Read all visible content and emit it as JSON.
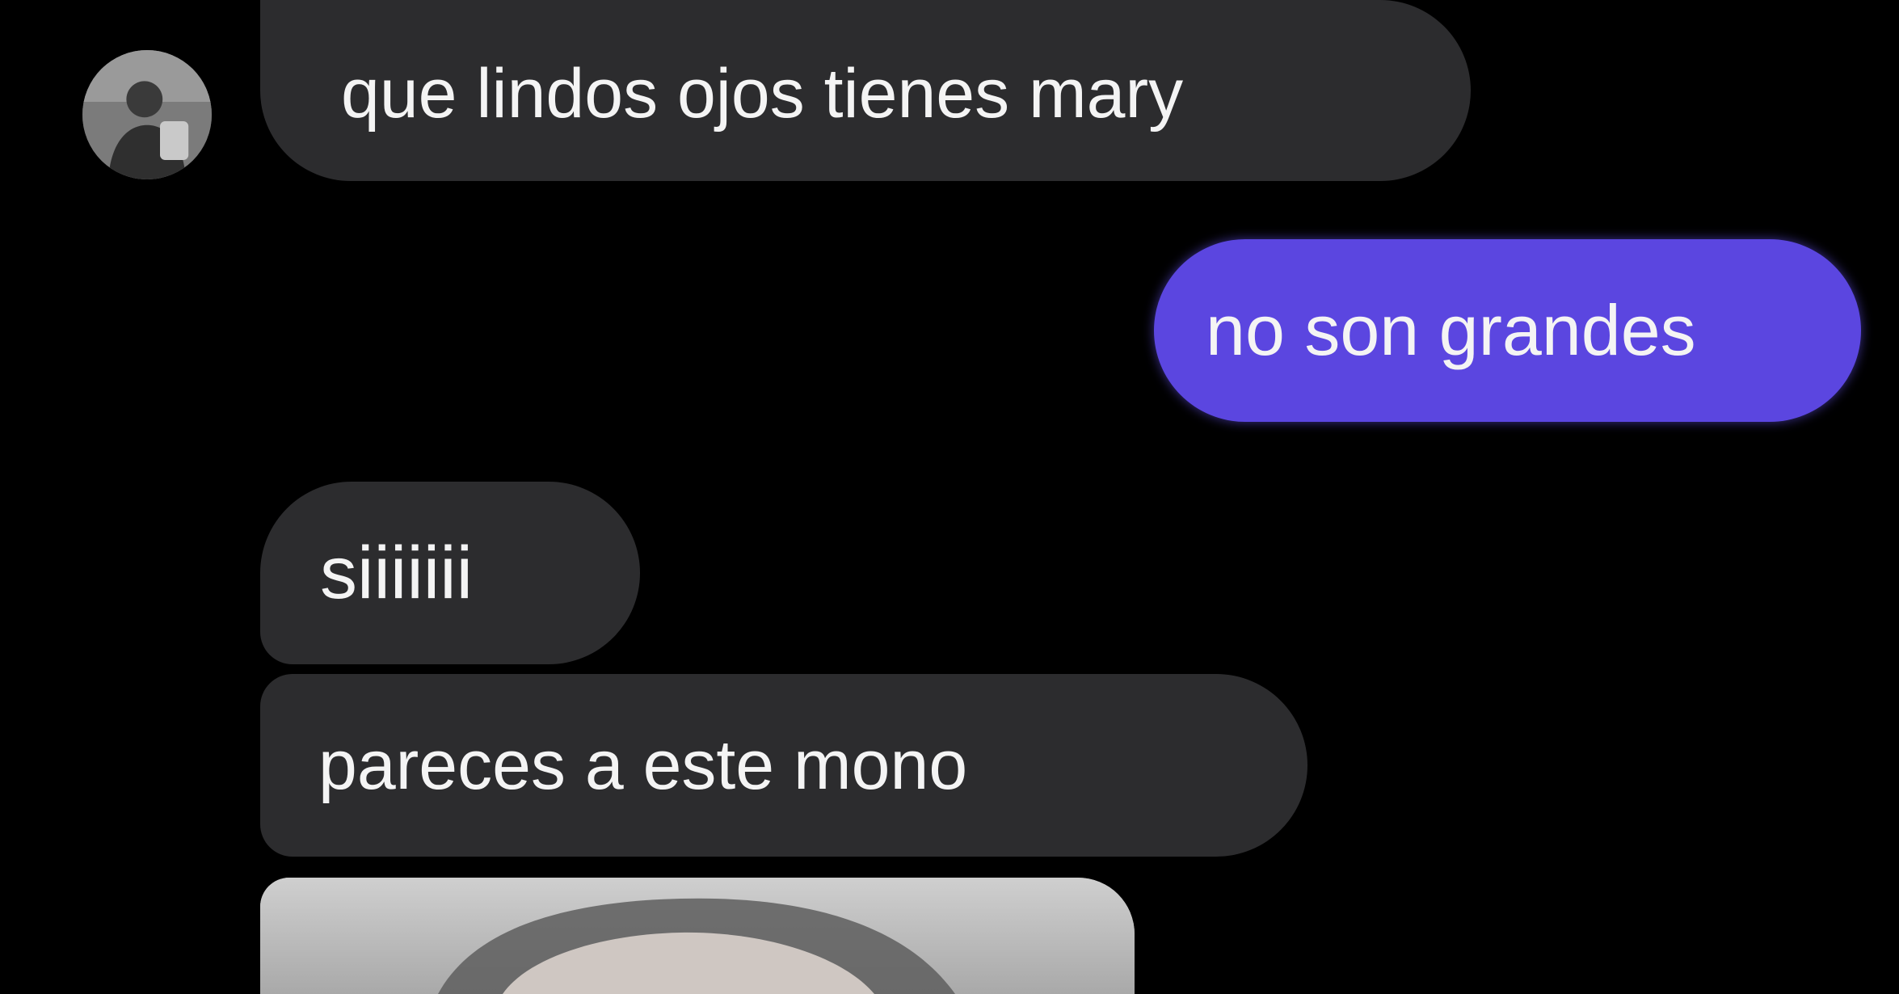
{
  "chat": {
    "contact_avatar_icon": "profile-photo",
    "messages": [
      {
        "direction": "incoming",
        "text": "que lindos ojos tienes mary"
      },
      {
        "direction": "outgoing",
        "text": "no son grandes"
      },
      {
        "direction": "incoming",
        "text": "siiiiiii"
      },
      {
        "direction": "incoming",
        "text": "pareces a este mono"
      },
      {
        "direction": "incoming",
        "type": "image",
        "icon": "photo-attachment"
      }
    ],
    "colors": {
      "background": "#000000",
      "incoming_bubble": "#2c2c2e",
      "outgoing_bubble": "#5b46e0",
      "text": "#f4f4f4"
    }
  }
}
